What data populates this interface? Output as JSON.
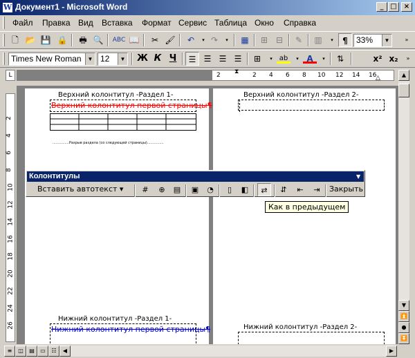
{
  "window": {
    "title": "Документ1 - Microsoft Word",
    "min": "_",
    "max": "□",
    "close": "×"
  },
  "menu": [
    "Файл",
    "Правка",
    "Вид",
    "Вставка",
    "Формат",
    "Сервис",
    "Таблица",
    "Окно",
    "Справка"
  ],
  "standard_toolbar": {
    "zoom": "33%",
    "show_marks": "¶"
  },
  "format_toolbar": {
    "font": "Times New Roman",
    "size": "12",
    "bold": "Ж",
    "italic": "К",
    "underline": "Ч",
    "superscript": "x²",
    "subscript": "x₂",
    "font_color_letter": "A",
    "highlight_letters": "ab"
  },
  "ruler": {
    "numbers": [
      "2",
      "2",
      "4",
      "6",
      "8",
      "10",
      "12",
      "14",
      "16"
    ],
    "vnumbers": [
      "2",
      "4",
      "6",
      "8",
      "10",
      "12",
      "14",
      "16",
      "18",
      "20",
      "22",
      "24",
      "26"
    ]
  },
  "page1": {
    "header_label": "Верхний колонтитул -Раздел 1-",
    "header_text": "Верхний колонтитул первой страницы¶",
    "section_break": "...............Разрыв раздела (со следующей страницы)...............",
    "footer_label": "Нижний колонтитул -Раздел 1-",
    "footer_text": "Нижний колонтитул первой страницы¶"
  },
  "page2": {
    "header_label": "Верхний колонтитул -Раздел 2-",
    "footer_label": "Нижний колонтитул -Раздел 2-"
  },
  "hf_toolbar": {
    "title": "Колонтитулы",
    "insert_autotext": "Вставить автотекст ▾",
    "close": "Закрыть",
    "tooltip": "Как в предыдущем"
  },
  "colors": {
    "title_bar": "#0a246a",
    "header_text": "#ff0000",
    "footer_text": "#0000cc"
  }
}
